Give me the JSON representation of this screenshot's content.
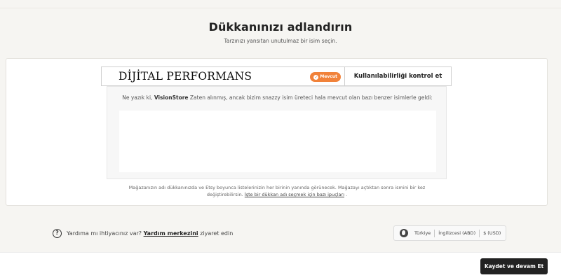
{
  "header": {
    "title": "Dükkanınızı adlandırın",
    "subtitle": "Tarzınızı yansıtan unutulmaz bir isim seçin."
  },
  "name_field": {
    "value": "DİJİTAL PERFORMANS",
    "status_badge": "Mevcut",
    "check_button_label": "Kullanılabilirliği kontrol et"
  },
  "result": {
    "prefix": "Ne yazık ki,",
    "taken_name": "VisionStore",
    "message": "Zaten alınmış, ancak bizim snazzy isim üreteci hala mevcut olan bazı benzer isimlerle geldi:"
  },
  "footnote": {
    "text": "Mağazanızın adı dükkanınızda ve Etsy boyunca listelerinizin her birinin yanında görünecek. Mağazayı açtıktan sonra ismini bir kez değiştirebilirsin.",
    "link": "İşte bir dükkan adı seçmek için bazı ipuçları",
    "suffix": "."
  },
  "help": {
    "icon": "question-circle-icon",
    "prefix": "Yardıma mı ihtiyacınız var?",
    "link": "Yardım merkezini",
    "suffix": "ziyaret edin"
  },
  "locale": {
    "icon": "globe-icon",
    "region": "Türkiye",
    "language": "İngilizcesi (ABD)",
    "currency": "$ (USD)"
  },
  "footer": {
    "save_button": "Kaydet ve devam Et"
  },
  "colors": {
    "accent": "#f1823a",
    "primary_button": "#222222",
    "page_background": "#f6f5f2"
  }
}
